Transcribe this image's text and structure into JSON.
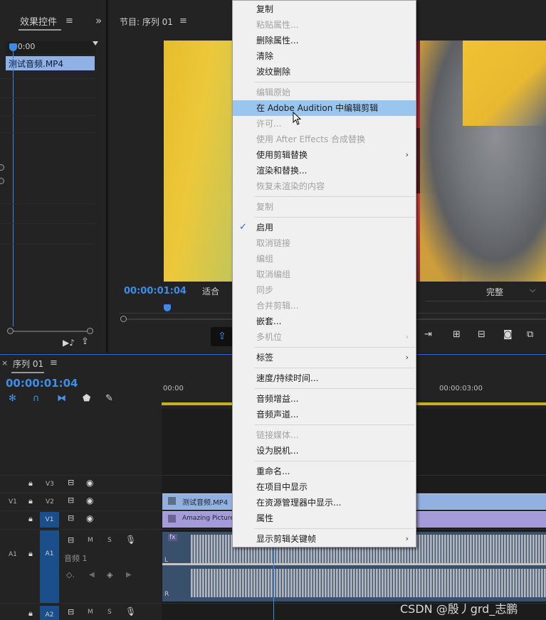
{
  "effect_controls": {
    "tab_label": "效果控件",
    "menu_icon": "≡",
    "expand_icon": "»",
    "ruler_time": ":00:00",
    "clip_name": "测试音频.MP4"
  },
  "program_monitor": {
    "title": "节目: 序列 01",
    "menu_icon": "≡",
    "timecode": "00:00:01:04",
    "fit_label": "适合",
    "quality_label": "完整"
  },
  "timeline": {
    "close_icon": "×",
    "sequence_name": "序列 01",
    "menu_icon": "≡",
    "timecode": "00:00:01:04",
    "ruler": [
      "00:00",
      "00:00:03:00"
    ],
    "tracks": {
      "v3": {
        "name": "V3"
      },
      "v2": {
        "name": "V2",
        "source": "V1"
      },
      "v1": {
        "name": "V1"
      },
      "a1": {
        "name": "A1",
        "source": "A1",
        "label": "音频 1",
        "mute": "M",
        "solo": "S"
      },
      "a2": {
        "name": "A2",
        "mute": "M",
        "solo": "S"
      }
    },
    "clips": {
      "v2": "测试音频.MP4",
      "v1": "Amazing Picture",
      "a1_fx": "fx",
      "a1_l": "L",
      "a1_r": "R"
    }
  },
  "context_menu": {
    "items": [
      {
        "label": "复制",
        "disabled": false
      },
      {
        "label": "粘贴属性...",
        "disabled": true
      },
      {
        "label": "删除属性...",
        "disabled": false
      },
      {
        "label": "清除",
        "disabled": false
      },
      {
        "label": "波纹删除",
        "disabled": false
      },
      {
        "label": "编辑原始",
        "disabled": true
      },
      {
        "label": "在 Adobe Audition 中编辑剪辑",
        "disabled": false,
        "highlighted": true
      },
      {
        "label": "许可...",
        "disabled": true
      },
      {
        "label": "使用 After Effects 合成替换",
        "disabled": true
      },
      {
        "label": "使用剪辑替换",
        "disabled": false,
        "submenu": true
      },
      {
        "label": "渲染和替换...",
        "disabled": false
      },
      {
        "label": "恢复未渲染的内容",
        "disabled": true
      },
      {
        "label": "复制",
        "disabled": true
      },
      {
        "label": "启用",
        "disabled": false,
        "checked": true
      },
      {
        "label": "取消链接",
        "disabled": true
      },
      {
        "label": "编组",
        "disabled": true
      },
      {
        "label": "取消编组",
        "disabled": true
      },
      {
        "label": "同步",
        "disabled": true
      },
      {
        "label": "合并剪辑...",
        "disabled": true
      },
      {
        "label": "嵌套...",
        "disabled": false
      },
      {
        "label": "多机位",
        "disabled": true,
        "submenu": true
      },
      {
        "label": "标签",
        "disabled": false,
        "submenu": true
      },
      {
        "label": "速度/持续时间...",
        "disabled": false
      },
      {
        "label": "音频增益...",
        "disabled": false
      },
      {
        "label": "音频声道...",
        "disabled": false
      },
      {
        "label": "链接媒体...",
        "disabled": true
      },
      {
        "label": "设为脱机...",
        "disabled": false
      },
      {
        "label": "重命名...",
        "disabled": false
      },
      {
        "label": "在项目中显示",
        "disabled": false
      },
      {
        "label": "在资源管理器中显示...",
        "disabled": false
      },
      {
        "label": "属性",
        "disabled": false
      },
      {
        "label": "显示剪辑关键帧",
        "disabled": false,
        "submenu": true
      }
    ],
    "submenu_arrow": "›",
    "check_mark": "✓"
  },
  "watermark": "CSDN @殷丿grd_志鹏"
}
